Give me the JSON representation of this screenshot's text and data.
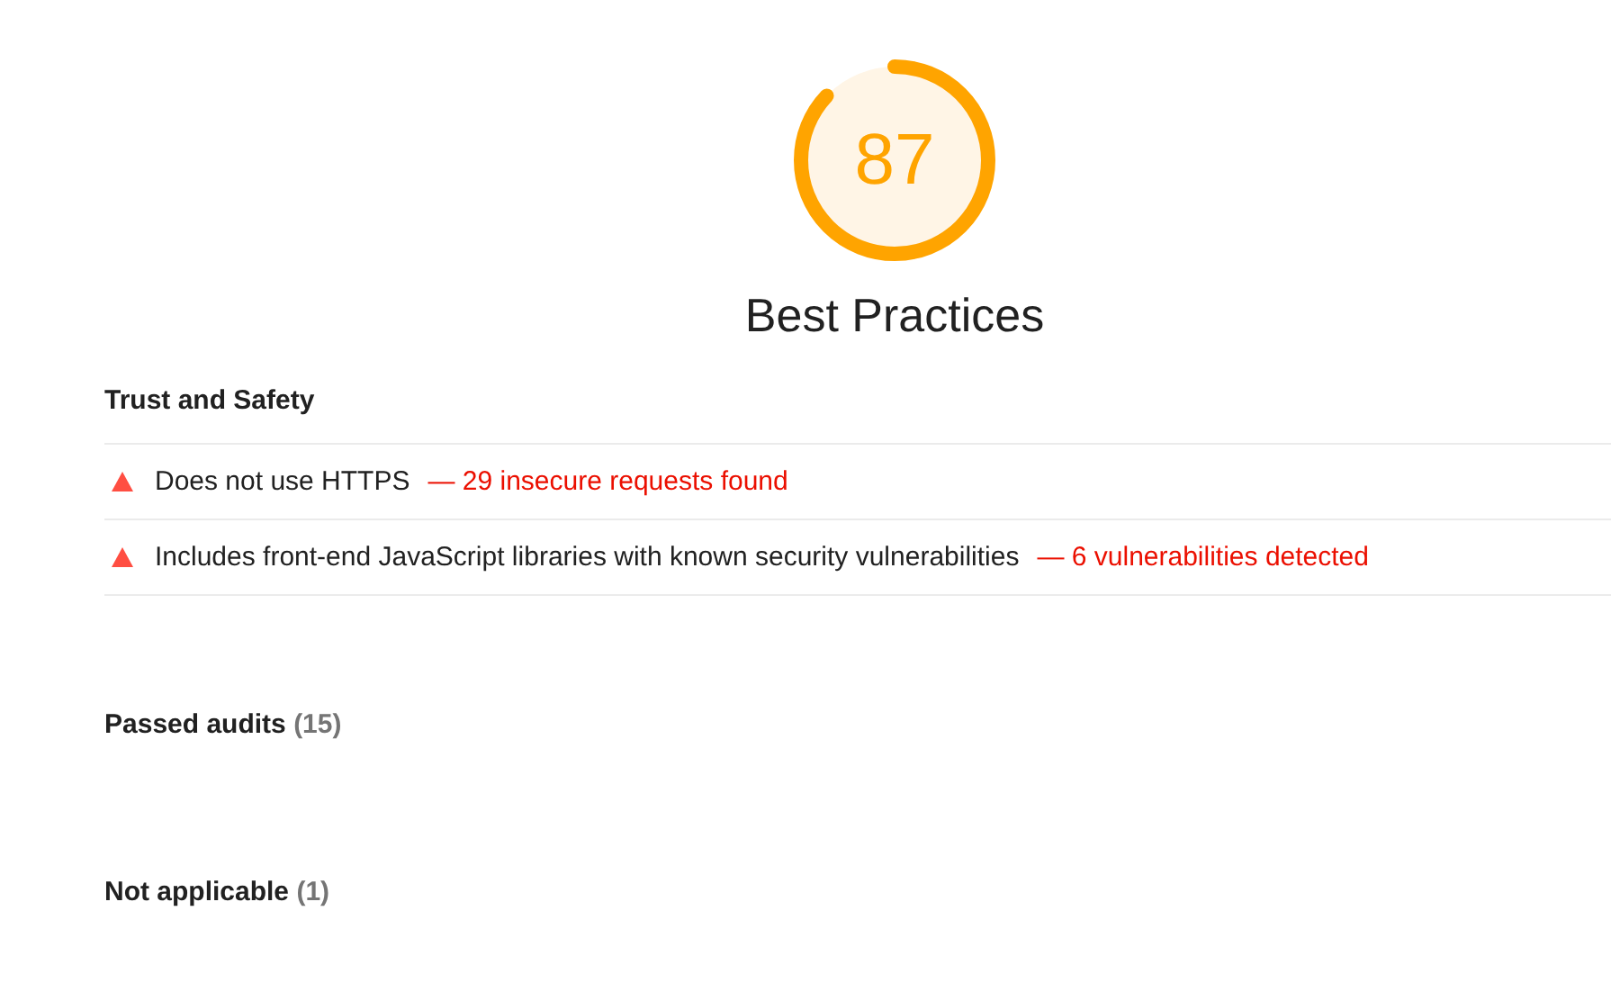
{
  "gauge": {
    "score": "87",
    "title": "Best Practices"
  },
  "group": {
    "title": "Trust and Safety",
    "audits": [
      {
        "title": "Does not use HTTPS",
        "detail": "— 29 insecure requests found",
        "failed": true
      },
      {
        "title": "Includes front-end JavaScript libraries with known security vulnerabilities",
        "detail": "— 6 vulnerabilities detected",
        "failed": true
      }
    ]
  },
  "sections": [
    {
      "title": "Passed audits",
      "count": "(15)"
    },
    {
      "title": "Not applicable",
      "count": "(1)"
    }
  ]
}
